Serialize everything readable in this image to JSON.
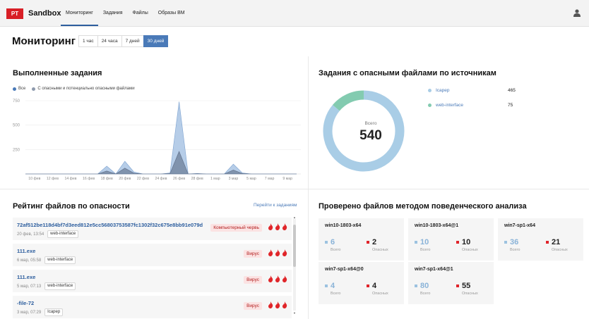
{
  "app": {
    "logo_text": "PT",
    "name": "Sandbox"
  },
  "nav": {
    "items": [
      {
        "label": "Мониторинг",
        "active": true
      },
      {
        "label": "Задания",
        "active": false
      },
      {
        "label": "Файлы",
        "active": false
      },
      {
        "label": "Образы ВМ",
        "active": false
      }
    ],
    "user_icon": "user-icon"
  },
  "header": {
    "title": "Мониторинг",
    "periods": [
      {
        "label": "1 час",
        "active": false
      },
      {
        "label": "24 часа",
        "active": false
      },
      {
        "label": "7 дней",
        "active": false
      },
      {
        "label": "30 дней",
        "active": true
      }
    ]
  },
  "tasks": {
    "title": "Выполненные задания",
    "legend": [
      {
        "label": "Все",
        "color": "#4a7ab8"
      },
      {
        "label": "С опасными и потенциально опасными файлами",
        "color": "#8e9aad"
      }
    ]
  },
  "chart_data": {
    "type": "area",
    "title": "Выполненные задания",
    "xlabel": "",
    "ylabel": "",
    "ylim": [
      0,
      750
    ],
    "yticks": [
      250,
      500,
      750
    ],
    "grid": true,
    "legend_position": "top-left",
    "x_tick_labels": [
      "10 фев",
      "12 фев",
      "14 фев",
      "16 фев",
      "18 фев",
      "20 фев",
      "22 фев",
      "24 фев",
      "26 фев",
      "28 фев",
      "1 мар",
      "3 мар",
      "5 мар",
      "7 мар",
      "9 мар"
    ],
    "x": [
      "9 фев",
      "10 фев",
      "11 фев",
      "12 фев",
      "13 фев",
      "14 фев",
      "15 фев",
      "16 фев",
      "17 фев",
      "18 фев",
      "19 фев",
      "20 фев",
      "21 фев",
      "22 фев",
      "23 фев",
      "24 фев",
      "25 фев",
      "26 фев",
      "27 фев",
      "28 фев",
      "29 фев",
      "1 мар",
      "2 мар",
      "3 мар",
      "4 мар",
      "5 мар",
      "6 мар",
      "7 мар",
      "8 мар",
      "9 мар",
      "10 мар"
    ],
    "series": [
      {
        "name": "Все",
        "color": "#a9c4e4",
        "values": [
          0,
          0,
          0,
          0,
          0,
          0,
          0,
          0,
          0,
          80,
          0,
          130,
          20,
          0,
          0,
          0,
          10,
          740,
          0,
          5,
          0,
          0,
          0,
          100,
          10,
          0,
          0,
          0,
          0,
          0,
          0
        ]
      },
      {
        "name": "С опасными и потенциально опасными файлами",
        "color": "#6e7f99",
        "values": [
          0,
          0,
          0,
          0,
          0,
          0,
          0,
          0,
          0,
          30,
          0,
          60,
          8,
          0,
          0,
          0,
          4,
          230,
          0,
          2,
          0,
          0,
          0,
          40,
          4,
          0,
          0,
          0,
          0,
          0,
          0
        ]
      }
    ]
  },
  "sources": {
    "title": "Задания с опасными файлами по источникам",
    "center_label": "Всего",
    "center_value": "540",
    "items": [
      {
        "name": "Icapep",
        "count": "465",
        "value": 465,
        "color": "#a9cde6"
      },
      {
        "name": "web-interface",
        "count": "75",
        "value": 75,
        "color": "#83cbb0"
      }
    ]
  },
  "rating": {
    "title": "Рейтинг файлов по опасности",
    "link": "Перейти к заданиям",
    "files": [
      {
        "name": "72af512be118d4bf7d3eed812e5cc56803753587fc1302f32c675e8bb91e079d",
        "date": "20 фев, 13:54",
        "source": "web-interface",
        "threat": "Компьютерный червь",
        "flames": 3
      },
      {
        "name": "111.exe",
        "date": "6 мар, 05:58",
        "source": "web-interface",
        "threat": "Вирус",
        "flames": 3
      },
      {
        "name": "111.exe",
        "date": "5 мар, 07:13",
        "source": "web-interface",
        "threat": "Вирус",
        "flames": 3
      },
      {
        "name": "-file-72",
        "date": "3 мар, 07:29",
        "source": "Icapep",
        "threat": "Вирус",
        "flames": 3
      }
    ]
  },
  "behavior": {
    "title": "Проверено файлов методом поведенческого анализа",
    "total_label": "Всего",
    "danger_label": "Опасных",
    "cards": [
      {
        "name": "win10-1803-x64",
        "total": "6",
        "danger": "2"
      },
      {
        "name": "win10-1803-x64@1",
        "total": "10",
        "danger": "10"
      },
      {
        "name": "win7-sp1-x64",
        "total": "36",
        "danger": "21"
      },
      {
        "name": "win7-sp1-x64@0",
        "total": "4",
        "danger": "4"
      },
      {
        "name": "win7-sp1-x64@1",
        "total": "80",
        "danger": "55"
      }
    ]
  }
}
